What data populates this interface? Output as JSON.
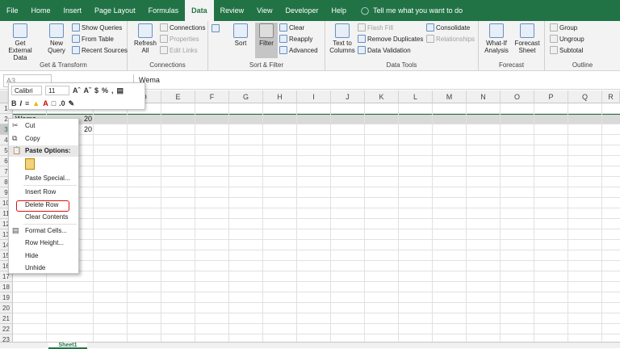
{
  "tabs": [
    "File",
    "Home",
    "Insert",
    "Page Layout",
    "Formulas",
    "Data",
    "Review",
    "View",
    "Developer",
    "Help"
  ],
  "active_tab": "Data",
  "tell_me": "Tell me what you want to do",
  "ribbon": {
    "get_transform": {
      "label": "Get & Transform",
      "get_external": "Get External Data",
      "new_query": "New Query",
      "show_queries": "Show Queries",
      "from_table": "From Table",
      "recent_sources": "Recent Sources"
    },
    "connections": {
      "label": "Connections",
      "refresh_all": "Refresh All",
      "connections": "Connections",
      "properties": "Properties",
      "edit_links": "Edit Links"
    },
    "sort_filter": {
      "label": "Sort & Filter",
      "sort": "Sort",
      "filter": "Filter",
      "clear": "Clear",
      "reapply": "Reapply",
      "advanced": "Advanced"
    },
    "data_tools": {
      "label": "Data Tools",
      "text_to_columns": "Text to Columns",
      "flash_fill": "Flash Fill",
      "remove_duplicates": "Remove Duplicates",
      "data_validation": "Data Validation",
      "consolidate": "Consolidate",
      "relationships": "Relationships"
    },
    "forecast": {
      "label": "Forecast",
      "what_if": "What-If Analysis",
      "forecast_sheet": "Forecast Sheet"
    },
    "outline": {
      "label": "Outline",
      "group": "Group",
      "ungroup": "Ungroup",
      "subtotal": "Subtotal"
    }
  },
  "namebox": "A3",
  "formula_value": "Wema",
  "columns": [
    "C",
    "D",
    "E",
    "F",
    "G",
    "H",
    "I",
    "J",
    "K",
    "L",
    "M",
    "N",
    "O",
    "P",
    "Q",
    "R"
  ],
  "rows": [
    "1",
    "2",
    "3",
    "4",
    "5",
    "6",
    "7",
    "8",
    "9",
    "10",
    "11",
    "12",
    "13",
    "14",
    "15",
    "16",
    "17",
    "18",
    "19",
    "20",
    "21",
    "22",
    "23",
    "24"
  ],
  "cells": {
    "r3_val": "20",
    "r4_val": "20",
    "a3": "Wema"
  },
  "mini_toolbar": {
    "font": "Calibri",
    "size": "11"
  },
  "context_menu": {
    "cut": "Cut",
    "copy": "Copy",
    "paste_options": "Paste Options:",
    "paste_special": "Paste Special...",
    "insert_row": "Insert Row",
    "delete_row": "Delete Row",
    "clear_contents": "Clear Contents",
    "format_cells": "Format Cells...",
    "row_height": "Row Height...",
    "hide": "Hide",
    "unhide": "Unhide"
  },
  "sheet_tab": "Sheet1",
  "colors": {
    "excel_green": "#217346",
    "highlight_red": "#d11111"
  }
}
